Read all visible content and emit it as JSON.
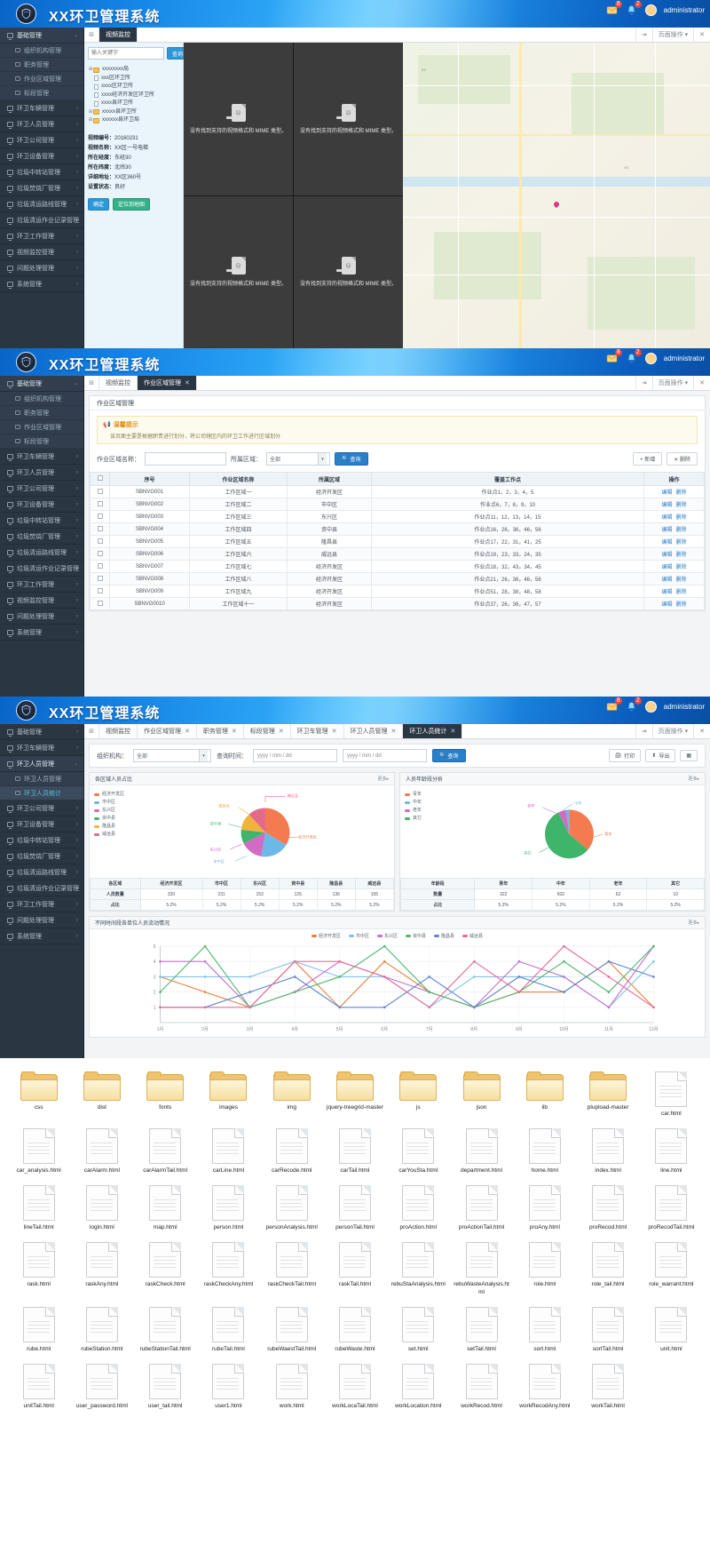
{
  "header": {
    "title": "XX环卫管理系统",
    "user": "administrator",
    "icons": [
      "mail-icon",
      "bell-icon",
      "user-avatar"
    ],
    "badge1": "8",
    "badge2": "2"
  },
  "sidebar": {
    "groups": [
      {
        "label": "基础管理",
        "open": true,
        "children": [
          {
            "label": "组织机构管理",
            "active": false
          },
          {
            "label": "职务管理",
            "active": false
          },
          {
            "label": "作业区域管理",
            "active": false
          },
          {
            "label": "标段管理",
            "active": false
          }
        ]
      },
      {
        "label": "环卫车辆管理"
      },
      {
        "label": "环卫人员管理"
      },
      {
        "label": "环卫公司管理"
      },
      {
        "label": "环卫设备管理"
      },
      {
        "label": "垃圾中转站管理"
      },
      {
        "label": "垃圾焚烧厂管理"
      },
      {
        "label": "垃圾清运路线管理"
      },
      {
        "label": "垃圾清运作业记录管理"
      },
      {
        "label": "环卫工作管理"
      },
      {
        "label": "视频监控管理"
      },
      {
        "label": "问题处理管理"
      },
      {
        "label": "系统管理"
      }
    ],
    "sidebar_c_groups": [
      {
        "label": "基础管理"
      },
      {
        "label": "环卫车辆管理"
      },
      {
        "label": "环卫人员管理",
        "open": true,
        "children": [
          {
            "label": "环卫人员管理",
            "active": false
          },
          {
            "label": "环卫人员统计",
            "active": true
          }
        ]
      },
      {
        "label": "环卫公司管理"
      },
      {
        "label": "环卫设备管理"
      },
      {
        "label": "垃圾中转站管理"
      },
      {
        "label": "垃圾焚烧厂管理"
      },
      {
        "label": "垃圾清运路线管理"
      },
      {
        "label": "垃圾清运作业记录管理"
      },
      {
        "label": "环卫工作管理"
      },
      {
        "label": "问题处理管理"
      },
      {
        "label": "系统管理"
      }
    ]
  },
  "panel_a": {
    "tabs": [
      {
        "label": "视频监控",
        "active": true,
        "closable": false
      }
    ],
    "tab_right": "页面操作 ▾",
    "search_placeholder": "输入关键字",
    "search_button": "查询",
    "tree": [
      {
        "label": "xxxxxxxx局",
        "level": 0,
        "type": "folder",
        "expander": "+"
      },
      {
        "label": "xxx区环卫所",
        "level": 1,
        "type": "file"
      },
      {
        "label": "xxxx区环卫所",
        "level": 1,
        "type": "file"
      },
      {
        "label": "xxxx经济开发区环卫所",
        "level": 1,
        "type": "file"
      },
      {
        "label": "xxxx县环卫所",
        "level": 1,
        "type": "file"
      },
      {
        "label": "xxxxx县环卫所",
        "level": 0,
        "type": "folder",
        "expander": "+"
      },
      {
        "label": "xxxxxx县环卫局",
        "level": 0,
        "type": "folder",
        "expander": "+"
      }
    ],
    "video_message": "没有找到支持的视频格式和 MIME 类型。",
    "video_count": 4,
    "info": [
      {
        "k": "视频编号：",
        "v": "20160231"
      },
      {
        "k": "视频名称：",
        "v": "XX区一号电梯"
      },
      {
        "k": "所在经度：",
        "v": "东经30"
      },
      {
        "k": "所在纬度：",
        "v": "北纬30"
      },
      {
        "k": "详细地址：",
        "v": "XX区360号"
      },
      {
        "k": "设置状态：",
        "v": "良好"
      }
    ],
    "buttons": {
      "confirm": "确定",
      "locate": "定位到地图"
    }
  },
  "panel_b": {
    "tabs": [
      {
        "label": "视频监控",
        "active": false,
        "closable": false
      },
      {
        "label": "作业区域管理",
        "active": true,
        "closable": true
      }
    ],
    "tab_right": "页面操作 ▾",
    "card_title": "作业区域管理",
    "tips_title": "温馨提示",
    "tips_body": "该页面主要是根据职责进行划分，将公司辖区内的环卫工作进行区域划分",
    "filter": {
      "name_label": "作业区域名称：",
      "name_value": "",
      "region_label": "所属区域：",
      "region_value": "全部",
      "search": "查询",
      "add": "新增",
      "delete": "删除"
    },
    "table": {
      "headers": [
        "",
        "序号",
        "作业区域名称",
        "所属区域",
        "覆盖工作点",
        "操作"
      ],
      "rows": [
        {
          "no": "SBNVG001",
          "name": "工作区域一",
          "region": "经济开发区",
          "points": "作业点1，2，3，4，5",
          "ops": [
            "编辑",
            "删除"
          ]
        },
        {
          "no": "SBNVG002",
          "name": "工作区域二",
          "region": "市中区",
          "points": "作业点6，7，8，9，10",
          "ops": [
            "编辑",
            "删除"
          ]
        },
        {
          "no": "SBNVG003",
          "name": "工作区域三",
          "region": "东兴区",
          "points": "作业点11，12，13，14，15",
          "ops": [
            "编辑",
            "删除"
          ]
        },
        {
          "no": "SBNVG004",
          "name": "工作区域四",
          "region": "资中县",
          "points": "作业点16，26，36，46，56",
          "ops": [
            "编辑",
            "删除"
          ]
        },
        {
          "no": "SBNVG005",
          "name": "工作区域五",
          "region": "隆昌县",
          "points": "作业点17，22，31，41，25",
          "ops": [
            "编辑",
            "删除"
          ]
        },
        {
          "no": "SBNVG006",
          "name": "工作区域六",
          "region": "威远县",
          "points": "作业点19，23，33，24，35",
          "ops": [
            "编辑",
            "删除"
          ]
        },
        {
          "no": "SBNVG007",
          "name": "工作区域七",
          "region": "经济开发区",
          "points": "作业点18，32，43，34，45",
          "ops": [
            "编辑",
            "删除"
          ]
        },
        {
          "no": "SBNVG008",
          "name": "工作区域八",
          "region": "经济开发区",
          "points": "作业点21，26，36，46，56",
          "ops": [
            "编辑",
            "删除"
          ]
        },
        {
          "no": "SBNVG009",
          "name": "工作区域九",
          "region": "经济开发区",
          "points": "作业点51，28，38，48，58",
          "ops": [
            "编辑",
            "删除"
          ]
        },
        {
          "no": "SBNVG0010",
          "name": "工作区域十一",
          "region": "经济开发区",
          "points": "作业点37，26，36，47，57",
          "ops": [
            "编辑",
            "删除"
          ]
        }
      ]
    }
  },
  "panel_c": {
    "tabs": [
      {
        "label": "视频监控",
        "active": false,
        "closable": false
      },
      {
        "label": "作业区域管理",
        "active": false,
        "closable": true
      },
      {
        "label": "职务管理",
        "active": false,
        "closable": true
      },
      {
        "label": "标段管理",
        "active": false,
        "closable": true
      },
      {
        "label": "环卫车管理",
        "active": false,
        "closable": true
      },
      {
        "label": "环卫人员管理",
        "active": false,
        "closable": true
      },
      {
        "label": "环卫人员统计",
        "active": true,
        "closable": true
      }
    ],
    "tab_right": "页面操作 ▾",
    "filter": {
      "org_label": "组织机构：",
      "org_value": "全部",
      "time_label": "查询时间：",
      "date_from": "yyyy / mm / dd",
      "date_to": "yyyy / mm / dd",
      "search": "查询",
      "print": "打印",
      "export": "导出"
    },
    "card1_title": "各区域人员占比",
    "card2_title": "人员年龄段分析",
    "card3_title": "不同时间段各单位人员流动情况",
    "more": "更多▸"
  },
  "chart_data": [
    {
      "type": "pie",
      "title": "各区域人员占比",
      "categories": [
        "经济开发区",
        "市中区",
        "东兴区",
        "资中县",
        "隆昌县",
        "威远县"
      ],
      "values": [
        320,
        231,
        153,
        125,
        136,
        155
      ],
      "colors": [
        "#f47a4f",
        "#6cb8e8",
        "#d06cc4",
        "#3fb56b",
        "#f2b23e",
        "#e46a8a"
      ],
      "legend_position": "left",
      "table": {
        "headers": [
          "各区域",
          "经济开发区",
          "市中区",
          "东兴区",
          "资中县",
          "隆昌县",
          "威远县"
        ],
        "rows": [
          {
            "label": "人员数量",
            "values": [
              "320",
              "231",
              "153",
              "125",
              "136",
              "155"
            ]
          },
          {
            "label": "占比",
            "values": [
              "5.2%",
              "5.2%",
              "5.2%",
              "5.2%",
              "5.2%",
              "5.2%"
            ]
          }
        ]
      }
    },
    {
      "type": "pie",
      "title": "人员年龄段分析",
      "categories": [
        "青年",
        "中年",
        "老年",
        "其它"
      ],
      "values": [
        322,
        602,
        62,
        10
      ],
      "colors": [
        "#f47a4f",
        "#6cb8e8",
        "#d06cc4",
        "#3fb56b"
      ],
      "legend_position": "left",
      "table": {
        "headers": [
          "年龄段",
          "青年",
          "中年",
          "老年",
          "其它"
        ],
        "rows": [
          {
            "label": "数量",
            "values": [
              "322",
              "602",
              "62",
              "10"
            ]
          },
          {
            "label": "占比",
            "values": [
              "5.2%",
              "5.2%",
              "5.2%",
              "5.2%"
            ]
          }
        ]
      }
    },
    {
      "type": "line",
      "title": "不同时间段各单位人员流动情况",
      "x": [
        "1月",
        "2月",
        "3月",
        "4月",
        "5月",
        "6月",
        "7月",
        "8月",
        "9月",
        "10月",
        "11月",
        "12月"
      ],
      "ylim": [
        0,
        5
      ],
      "yticks": [
        1,
        2,
        3,
        4,
        5
      ],
      "grid": true,
      "legend_position": "top",
      "series": [
        {
          "name": "经济开发区",
          "color": "#e8803c",
          "values": [
            3,
            2,
            1,
            4,
            1,
            4,
            2,
            1,
            2,
            2,
            4,
            1
          ]
        },
        {
          "name": "市中区",
          "color": "#7fc3e8",
          "values": [
            3,
            3,
            3,
            4,
            3,
            3,
            1,
            3,
            3,
            3,
            1,
            4
          ]
        },
        {
          "name": "东兴区",
          "color": "#c36fd0",
          "values": [
            4,
            4,
            1,
            2,
            4,
            3,
            2,
            1,
            4,
            3,
            1,
            5
          ]
        },
        {
          "name": "资中县",
          "color": "#4fb86a",
          "values": [
            2,
            5,
            1,
            2,
            3,
            5,
            2,
            1,
            2,
            4,
            2,
            5
          ]
        },
        {
          "name": "隆昌县",
          "color": "#5b85d0",
          "values": [
            1,
            1,
            2,
            3,
            1,
            1,
            3,
            1,
            3,
            2,
            4,
            3
          ]
        },
        {
          "name": "威远县",
          "color": "#e8689a",
          "values": [
            1,
            1,
            1,
            4,
            4,
            3,
            1,
            4,
            2,
            5,
            3,
            1
          ]
        }
      ]
    }
  ],
  "files": [
    {
      "name": "css",
      "type": "folder"
    },
    {
      "name": "dist",
      "type": "folder"
    },
    {
      "name": "fonts",
      "type": "folder"
    },
    {
      "name": "images",
      "type": "folder"
    },
    {
      "name": "img",
      "type": "folder"
    },
    {
      "name": "jquery-treegrid-master",
      "type": "folder"
    },
    {
      "name": "js",
      "type": "folder"
    },
    {
      "name": "json",
      "type": "folder"
    },
    {
      "name": "lib",
      "type": "folder"
    },
    {
      "name": "plupload-master",
      "type": "folder"
    },
    {
      "name": "car.html",
      "type": "file"
    },
    {
      "name": "car_analysis.html",
      "type": "file"
    },
    {
      "name": "carAlarm.html",
      "type": "file"
    },
    {
      "name": "carAlarmTail.html",
      "type": "file"
    },
    {
      "name": "carLine.html",
      "type": "file"
    },
    {
      "name": "carRecode.html",
      "type": "file"
    },
    {
      "name": "carTail.html",
      "type": "file"
    },
    {
      "name": "carYouSta.html",
      "type": "file"
    },
    {
      "name": "department.html",
      "type": "file"
    },
    {
      "name": "home.html",
      "type": "file"
    },
    {
      "name": "index.html",
      "type": "file"
    },
    {
      "name": "line.html",
      "type": "file"
    },
    {
      "name": "lineTail.html",
      "type": "file"
    },
    {
      "name": "login.html",
      "type": "file"
    },
    {
      "name": "map.html",
      "type": "file"
    },
    {
      "name": "person.html",
      "type": "file"
    },
    {
      "name": "personAnalysis.html",
      "type": "file"
    },
    {
      "name": "personTail.html",
      "type": "file"
    },
    {
      "name": "proAction.html",
      "type": "file"
    },
    {
      "name": "proActionTail.html",
      "type": "file"
    },
    {
      "name": "proAny.html",
      "type": "file"
    },
    {
      "name": "proRecod.html",
      "type": "file"
    },
    {
      "name": "proRecodTail.html",
      "type": "file"
    },
    {
      "name": "rask.html",
      "type": "file"
    },
    {
      "name": "raskAny.html",
      "type": "file"
    },
    {
      "name": "raskCheck.html",
      "type": "file"
    },
    {
      "name": "raskCheckAny.html",
      "type": "file"
    },
    {
      "name": "raskCheckTail.html",
      "type": "file"
    },
    {
      "name": "raskTail.html",
      "type": "file"
    },
    {
      "name": "rebuStaAnalysis.html",
      "type": "file"
    },
    {
      "name": "rebuWasteAnalysis.html",
      "type": "file"
    },
    {
      "name": "role.html",
      "type": "file"
    },
    {
      "name": "role_tail.html",
      "type": "file"
    },
    {
      "name": "role_warrant.html",
      "type": "file"
    },
    {
      "name": "rube.html",
      "type": "file"
    },
    {
      "name": "rubeStation.html",
      "type": "file"
    },
    {
      "name": "rubeStationTail.html",
      "type": "file"
    },
    {
      "name": "rubeTail.html",
      "type": "file"
    },
    {
      "name": "rubeWaestTail.html",
      "type": "file"
    },
    {
      "name": "rubeWaste.html",
      "type": "file"
    },
    {
      "name": "set.html",
      "type": "file"
    },
    {
      "name": "setTail.html",
      "type": "file"
    },
    {
      "name": "sort.html",
      "type": "file"
    },
    {
      "name": "sortTail.html",
      "type": "file"
    },
    {
      "name": "unit.html",
      "type": "file"
    },
    {
      "name": "unitTail.html",
      "type": "file"
    },
    {
      "name": "user_password.html",
      "type": "file"
    },
    {
      "name": "user_tail.html",
      "type": "file"
    },
    {
      "name": "user1.html",
      "type": "file"
    },
    {
      "name": "work.html",
      "type": "file"
    },
    {
      "name": "workLocaTail.html",
      "type": "file"
    },
    {
      "name": "workLocation.html",
      "type": "file"
    },
    {
      "name": "workRecod.html",
      "type": "file"
    },
    {
      "name": "workRecodAny.html",
      "type": "file"
    },
    {
      "name": "workTail.html",
      "type": "file"
    }
  ]
}
